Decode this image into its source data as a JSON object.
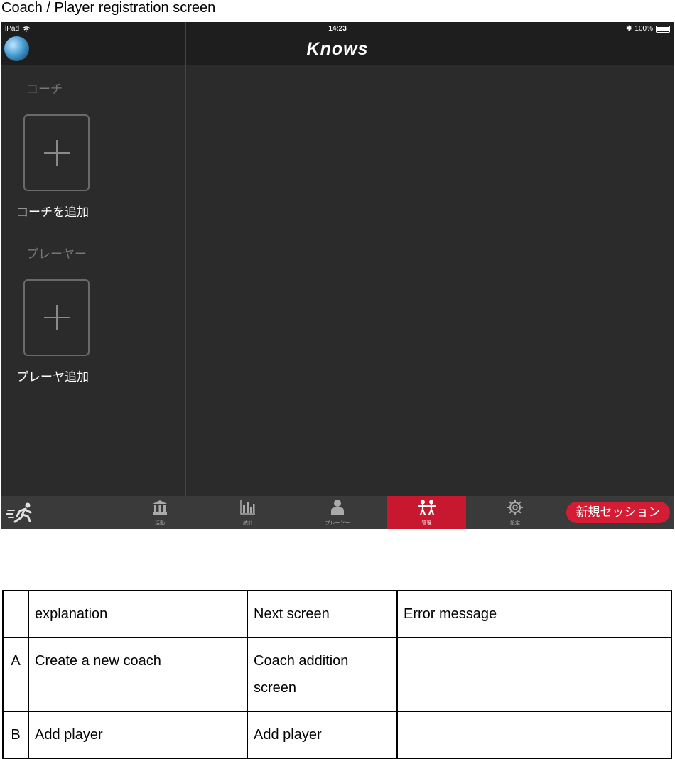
{
  "caption": "Coach / Player registration screen",
  "status": {
    "device": "iPad",
    "time": "14:23",
    "battery": "100%"
  },
  "app": {
    "logo": "Knows"
  },
  "coach": {
    "section": "コーチ",
    "add_label": "コーチを追加"
  },
  "player": {
    "section": "プレーヤー",
    "add_label": "プレーヤ追加"
  },
  "tabs": [
    {
      "label": "活動",
      "icon": "bank-icon"
    },
    {
      "label": "統計",
      "icon": "bar-chart-icon"
    },
    {
      "label": "プレーヤー",
      "icon": "person-icon"
    },
    {
      "label": "管理",
      "icon": "people-icon",
      "active": true
    },
    {
      "label": "設定",
      "icon": "gear-icon"
    }
  ],
  "new_session": "新規セッション",
  "table": {
    "headers": [
      "",
      "explanation",
      "Next screen",
      "Error message"
    ],
    "rows": [
      {
        "key": "A",
        "explanation": "Create a new coach",
        "next": "Coach addition screen",
        "error": ""
      },
      {
        "key": "B",
        "explanation": "Add player",
        "next": "Add player",
        "error": ""
      }
    ]
  },
  "colors": {
    "accent": "#c8182f",
    "background": "#2b2b2b",
    "bar": "#1e1e1e"
  }
}
